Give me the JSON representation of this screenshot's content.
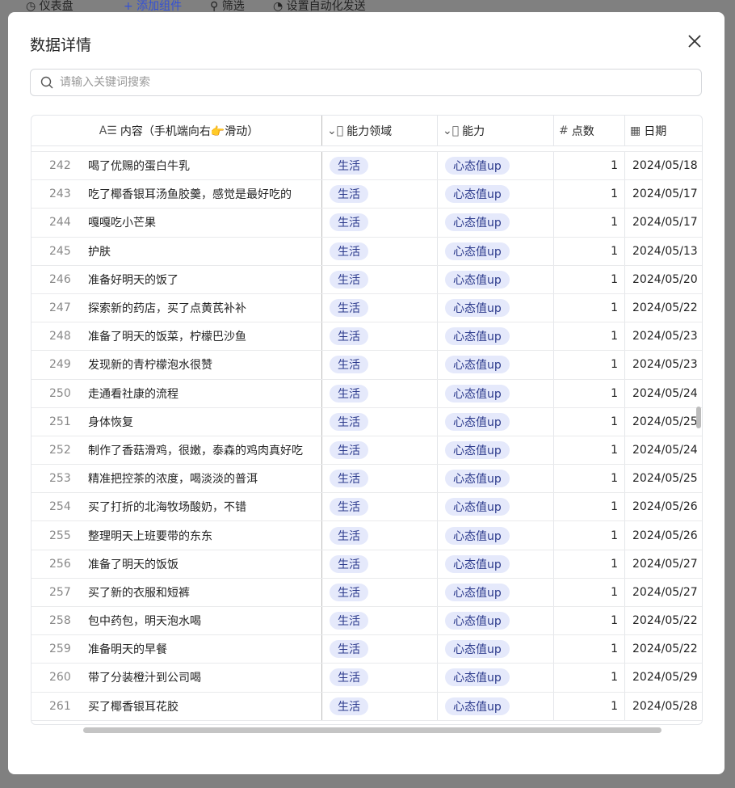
{
  "topbar": {
    "dashboard": "仪表盘",
    "add_widget": "+ 添加组件",
    "filter": "筛选",
    "auto_send": "设置自动化发送"
  },
  "modal": {
    "title": "数据详情",
    "search_placeholder": "请输入关键词搜索"
  },
  "columns": {
    "content": "内容（手机端向右👉滑动）",
    "domain": "能力领域",
    "ability": "能力",
    "points": "点数",
    "date": "日期"
  },
  "rows": [
    {
      "n": "242",
      "t": "喝了优赐的蛋白牛乳",
      "d": "生活",
      "a": "心态值up",
      "p": "1",
      "dt": "2024/05/18"
    },
    {
      "n": "243",
      "t": "吃了椰香银耳汤鱼胶羹，感觉是最好吃的",
      "d": "生活",
      "a": "心态值up",
      "p": "1",
      "dt": "2024/05/17"
    },
    {
      "n": "244",
      "t": "嘎嘎吃小芒果",
      "d": "生活",
      "a": "心态值up",
      "p": "1",
      "dt": "2024/05/17"
    },
    {
      "n": "245",
      "t": "护肤",
      "d": "生活",
      "a": "心态值up",
      "p": "1",
      "dt": "2024/05/13"
    },
    {
      "n": "246",
      "t": "准备好明天的饭了",
      "d": "生活",
      "a": "心态值up",
      "p": "1",
      "dt": "2024/05/20"
    },
    {
      "n": "247",
      "t": "探索新的药店，买了点黄芪补补",
      "d": "生活",
      "a": "心态值up",
      "p": "1",
      "dt": "2024/05/22"
    },
    {
      "n": "248",
      "t": "准备了明天的饭菜，柠檬巴沙鱼",
      "d": "生活",
      "a": "心态值up",
      "p": "1",
      "dt": "2024/05/23"
    },
    {
      "n": "249",
      "t": "发现新的青柠檬泡水很赞",
      "d": "生活",
      "a": "心态值up",
      "p": "1",
      "dt": "2024/05/23"
    },
    {
      "n": "250",
      "t": "走通看社康的流程",
      "d": "生活",
      "a": "心态值up",
      "p": "1",
      "dt": "2024/05/24"
    },
    {
      "n": "251",
      "t": "身体恢复",
      "d": "生活",
      "a": "心态值up",
      "p": "1",
      "dt": "2024/05/25"
    },
    {
      "n": "252",
      "t": "制作了香菇滑鸡，很嫩，泰森的鸡肉真好吃",
      "d": "生活",
      "a": "心态值up",
      "p": "1",
      "dt": "2024/05/24"
    },
    {
      "n": "253",
      "t": "精准把控茶的浓度，喝淡淡的普洱",
      "d": "生活",
      "a": "心态值up",
      "p": "1",
      "dt": "2024/05/25"
    },
    {
      "n": "254",
      "t": "买了打折的北海牧场酸奶，不错",
      "d": "生活",
      "a": "心态值up",
      "p": "1",
      "dt": "2024/05/26"
    },
    {
      "n": "255",
      "t": "整理明天上班要带的东东",
      "d": "生活",
      "a": "心态值up",
      "p": "1",
      "dt": "2024/05/26"
    },
    {
      "n": "256",
      "t": "准备了明天的饭饭",
      "d": "生活",
      "a": "心态值up",
      "p": "1",
      "dt": "2024/05/27"
    },
    {
      "n": "257",
      "t": "买了新的衣服和短裤",
      "d": "生活",
      "a": "心态值up",
      "p": "1",
      "dt": "2024/05/27"
    },
    {
      "n": "258",
      "t": "包中药包，明天泡水喝",
      "d": "生活",
      "a": "心态值up",
      "p": "1",
      "dt": "2024/05/22"
    },
    {
      "n": "259",
      "t": "准备明天的早餐",
      "d": "生活",
      "a": "心态值up",
      "p": "1",
      "dt": "2024/05/22"
    },
    {
      "n": "260",
      "t": "带了分装橙汁到公司喝",
      "d": "生活",
      "a": "心态值up",
      "p": "1",
      "dt": "2024/05/29"
    },
    {
      "n": "261",
      "t": "买了椰香银耳花胶",
      "d": "生活",
      "a": "心态值up",
      "p": "1",
      "dt": "2024/05/28"
    }
  ]
}
